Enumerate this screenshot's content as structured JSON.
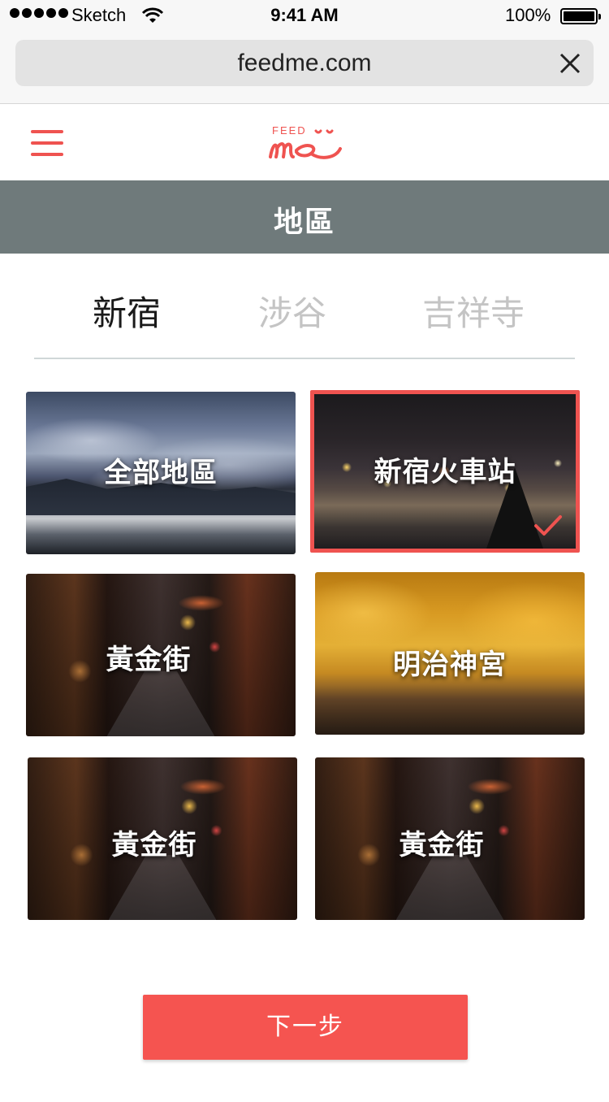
{
  "status_bar": {
    "carrier": "Sketch",
    "time": "9:41 AM",
    "battery": "100%",
    "icons": [
      "signal-dots-icon",
      "wifi-icon",
      "battery-icon"
    ]
  },
  "browser": {
    "url": "feedme.com",
    "close_icon": "close-icon"
  },
  "header": {
    "menu_icon": "hamburger-menu-icon",
    "logo_text": "FEED me"
  },
  "page": {
    "title": "地區"
  },
  "tabs": [
    {
      "label": "新宿",
      "active": true
    },
    {
      "label": "涉谷",
      "active": false
    },
    {
      "label": "吉祥寺",
      "active": false
    }
  ],
  "areas": [
    {
      "label": "全部地區",
      "selected": false
    },
    {
      "label": "新宿火車站",
      "selected": true
    },
    {
      "label": "黃金街",
      "selected": false
    },
    {
      "label": "明治神宮",
      "selected": false
    },
    {
      "label": "黃金街",
      "selected": false
    },
    {
      "label": "黃金街",
      "selected": false
    }
  ],
  "actions": {
    "next_label": "下一步"
  },
  "colors": {
    "accent": "#f55450",
    "title_band": "#6f7a7b",
    "tab_inactive": "#c4c4c4"
  }
}
